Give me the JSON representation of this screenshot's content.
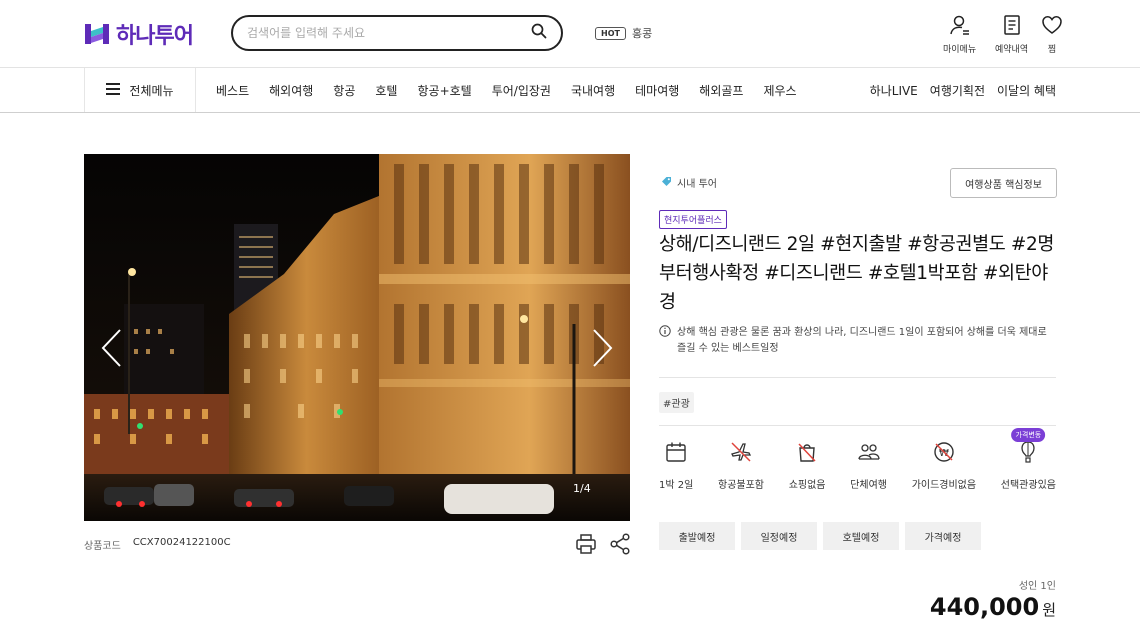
{
  "header": {
    "logo_text": "하나투어",
    "search_placeholder": "검색어를 입력해 주세요",
    "hot_badge": "HOT",
    "hot_keyword": "홍콩",
    "util": [
      {
        "label": "마이메뉴",
        "icon": "person-icon"
      },
      {
        "label": "예약내역",
        "icon": "document-icon"
      },
      {
        "label": "찜",
        "icon": "heart-icon"
      }
    ]
  },
  "nav": {
    "all_menu": "전체메뉴",
    "items": [
      "베스트",
      "해외여행",
      "항공",
      "호텔",
      "항공+호텔",
      "투어/입장권",
      "국내여행",
      "테마여행",
      "해외골프",
      "제우스"
    ],
    "right_items": [
      "하나LIVE",
      "여행기획전",
      "이달의 혜택"
    ]
  },
  "gallery": {
    "counter": "1/4"
  },
  "product": {
    "code_label": "상품코드",
    "code": "CCX70024122100C",
    "category": "시내 투어",
    "key_info_button": "여행상품 핵심정보",
    "tag": "현지투어플러스",
    "title": "상해/디즈니랜드 2일 #현지출발 #항공권별도 #2명부터행사확정 #디즈니랜드 #호텔1박포함 #외탄야경",
    "description": "상해 핵심 관광은 물론 꿈과 환상의 나라, 디즈니랜드 1일이 포함되어 상해를 더욱 제대로 즐길 수 있는 베스트일정",
    "hashtag": "#관광",
    "features": [
      {
        "label": "1박 2일",
        "icon": "calendar-icon"
      },
      {
        "label": "항공불포함",
        "icon": "no-flight-icon"
      },
      {
        "label": "쇼핑없음",
        "icon": "no-shopping-icon"
      },
      {
        "label": "단체여행",
        "icon": "group-icon"
      },
      {
        "label": "가이드경비없음",
        "icon": "no-guide-fee-icon"
      },
      {
        "label": "선택관광있음",
        "icon": "balloon-icon",
        "badge": "가격변동"
      }
    ],
    "schedule_buttons": [
      "출발예정",
      "일정예정",
      "호텔예정",
      "가격예정"
    ],
    "price_label": "성인 1인",
    "price": "440,000",
    "currency": "원"
  },
  "colors": {
    "brand": "#5e2bb8",
    "badge_purple": "#7b3fd6",
    "tag_blue": "#4bb0d6"
  }
}
